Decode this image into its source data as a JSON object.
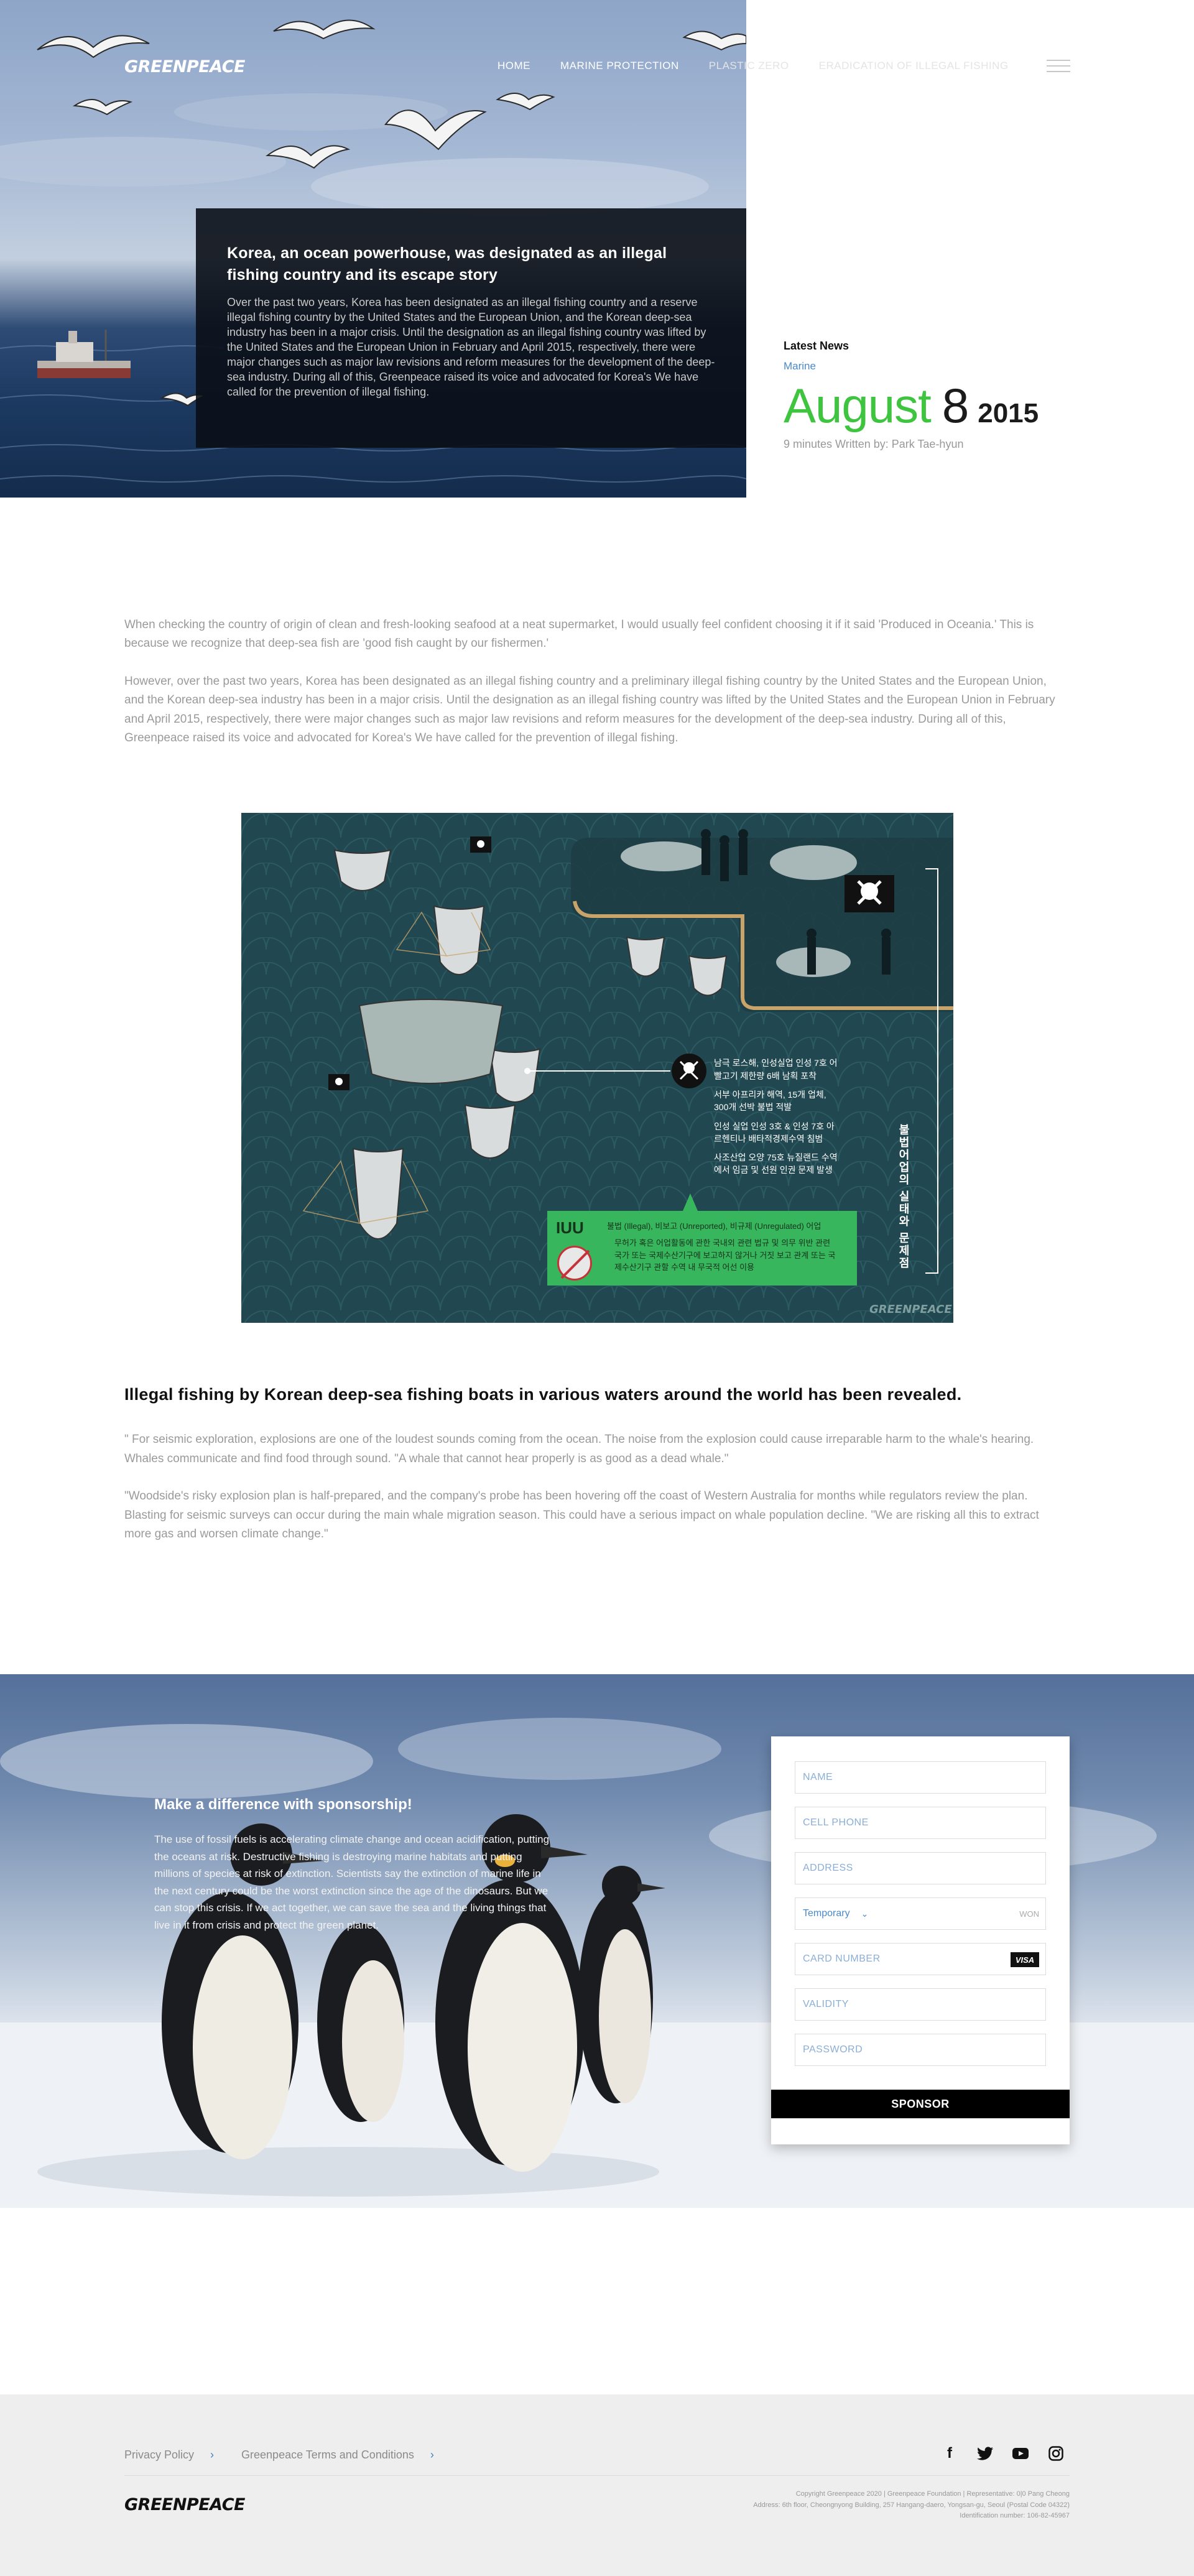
{
  "nav": {
    "logo": "GREENPEACE",
    "links": [
      "HOME",
      "MARINE PROTECTION",
      "PLASTIC ZERO",
      "ERADICATION OF ILLEGAL FISHING"
    ]
  },
  "hero": {
    "title": "Korea, an ocean powerhouse, was designated as an illegal fishing country and its escape story",
    "summary": "Over the past two years, Korea has been designated as an illegal fishing country and a reserve illegal fishing country by the United States and the European Union, and the Korean deep-sea industry has been in a major crisis. Until the designation as an illegal fishing country was lifted by the United States and the European Union in February and April 2015, respectively, there were major changes such as major law revisions and reform measures for the development of the deep-sea industry. During all of this, Greenpeace raised its voice and advocated for Korea's We have called for the prevention of illegal fishing."
  },
  "latest": {
    "heading": "Latest News",
    "category": "Marine",
    "month": "August",
    "day": "8",
    "year": "2015",
    "meta": "9 minutes Written by: Park Tae-hyun"
  },
  "article": {
    "paragraphs": [
      "When checking the country of origin of clean and fresh-looking seafood at a neat supermarket, I would usually feel confident choosing it if it said 'Produced in Oceania.' This is because we recognize that deep-sea fish are 'good fish caught by our fishermen.'",
      "However, over the past two years, Korea has been designated as an illegal fishing country and a preliminary illegal fishing country by the United States and the European Union, and the Korean deep-sea industry has been in a major crisis. Until the designation as an illegal fishing country was lifted by the United States and the European Union in February and April 2015, respectively, there were major changes such as major law revisions and reform measures for the development of the deep-sea industry. During all of this, Greenpeace raised its voice and advocated for Korea's We have called for the prevention of illegal fishing."
    ],
    "subheading": "Illegal fishing by Korean deep-sea fishing boats in various waters around the world has been revealed.",
    "quotes": [
      "\" For seismic exploration, explosions are one of the loudest sounds coming from the ocean. The noise from the explosion could cause irreparable harm to the whale's hearing. Whales communicate and find food through sound. \"A whale that cannot hear properly is as good as a dead whale.\"",
      "\"Woodside's risky explosion plan is half-prepared, and the company's probe has been hovering off the coast of Western Australia for months while regulators review the plan. Blasting for seismic surveys can occur during the main whale migration season. This could have a serious impact on whale population decline. \"We are risking all this to extract more gas and worsen climate change.\""
    ]
  },
  "infographic": {
    "cases": [
      "남극 로스해, 인성실업 인성 7호 어빨고기 제한량 6배 남획 포착",
      "서부 아프리카 해역, 15개 업체, 300개 선박 불법 적발",
      "인성 실업 인성 3호 & 인성 7호 아르헨티나 배타적경제수역 침범",
      "사조산업 오양 75호 뉴질랜드 수역에서 임금 및 선원 인권 문제 발생"
    ],
    "iuu_label": "IUU",
    "iuu_definition": "불법 (Illegal), 비보고 (Unreported), 비규제 (Unregulated) 어업",
    "iuu_description": "무허가 혹은 어업활동에 관한 국내외 관련 법규 및 의무 위반 관련 국가 또는 국제수산기구에 보고하지 않거나 거짓 보고 관계 또는 국제수산기구 관할 수역 내 무국적 어선 이용",
    "vertical_title": "불법어업의 실태와 문제점",
    "logo": "GREENPEACE"
  },
  "sponsor": {
    "heading": "Make a difference with sponsorship!",
    "body": "The use of fossil fuels is accelerating climate change and ocean acidification, putting the oceans at risk. Destructive fishing is destroying marine habitats and putting millions of species at risk of extinction. Scientists say the extinction of marine life in the next century could be the worst extinction since the age of the dinosaurs. But we can stop this crisis. If we act together, we can save the sea and the living things that live in it from crisis and protect the green planet.",
    "form": {
      "name": "NAME",
      "phone": "CELL PHONE",
      "address": "ADDRESS",
      "type_value": "Temporary",
      "currency": "WON",
      "card": "CARD NUMBER",
      "card_brand": "VISA",
      "validity": "VALIDITY",
      "password": "PASSWORD",
      "submit": "SPONSOR"
    }
  },
  "footer": {
    "links": [
      "Privacy Policy",
      "Greenpeace Terms and Conditions"
    ],
    "socials": [
      "facebook-icon",
      "twitter-icon",
      "youtube-icon",
      "instagram-icon"
    ],
    "logo": "GREENPEACE",
    "legal": [
      "Copyright Greenpeace 2020 | Greenpeace Foundation | Representative: 0|0 Pang Cheong",
      "Address: 6th floor, Cheongnyong Building, 257 Hangang-daero, Yongsan-gu, Seoul (Postal Code 04322)",
      "Identification number: 106-82-45967"
    ]
  },
  "colors": {
    "accent_green": "#3ec43e",
    "link_blue": "#4a89c9",
    "info_bg": "#214850",
    "iuu_green": "#37b65d"
  }
}
